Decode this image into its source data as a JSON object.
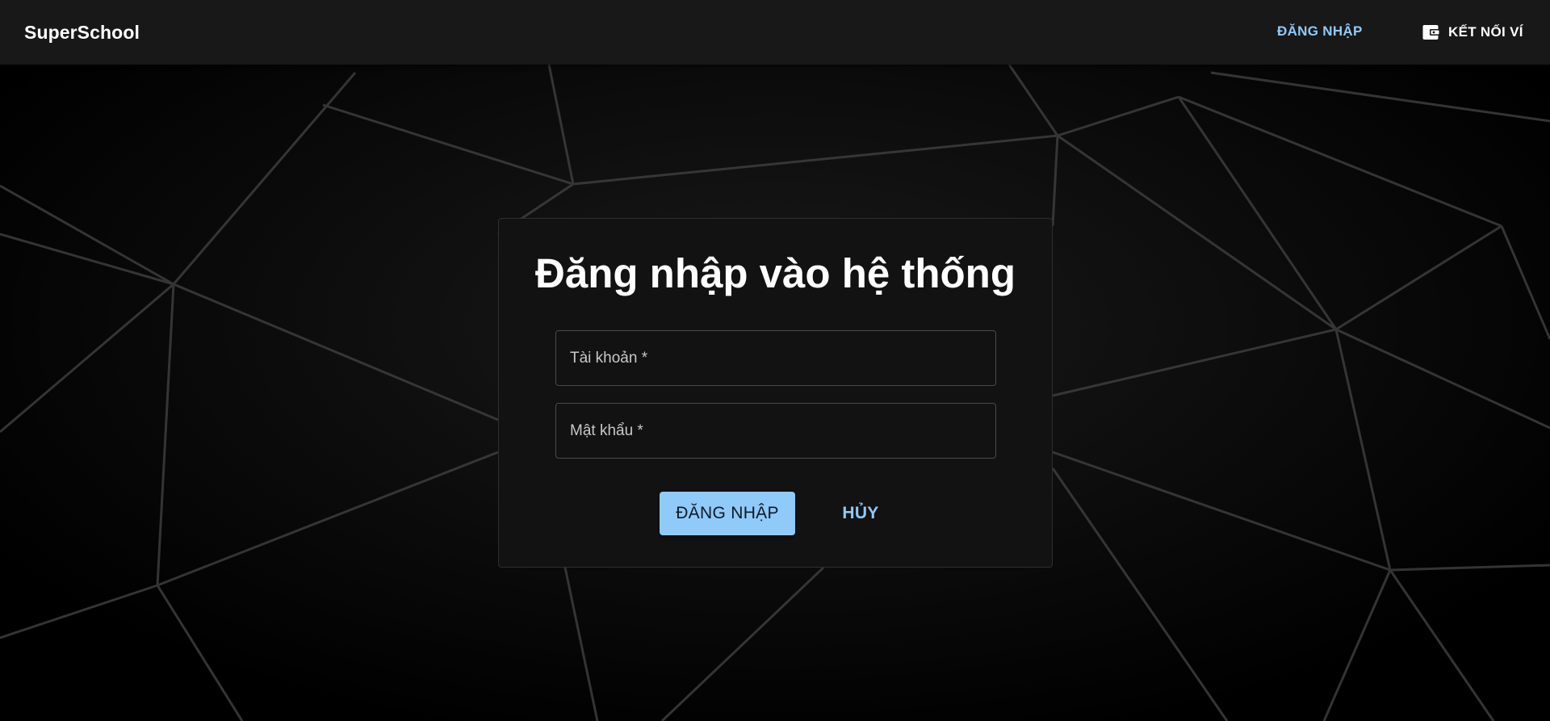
{
  "app": {
    "brand": "SuperSchool"
  },
  "nav": {
    "login_label": "ĐĂNG NHẬP",
    "wallet_label": "KẾT NỐI VÍ",
    "wallet_icon": "wallet-icon"
  },
  "login_form": {
    "title": "Đăng nhập vào hệ thống",
    "username_label": "Tài khoản *",
    "username_value": "",
    "password_label": "Mật khẩu *",
    "password_value": "",
    "submit_label": "ĐĂNG NHẬP",
    "cancel_label": "HỦY"
  },
  "colors": {
    "accent": "#90caf9",
    "topbar_bg": "#181818",
    "card_bg": "#121212",
    "page_bg": "#000000"
  }
}
